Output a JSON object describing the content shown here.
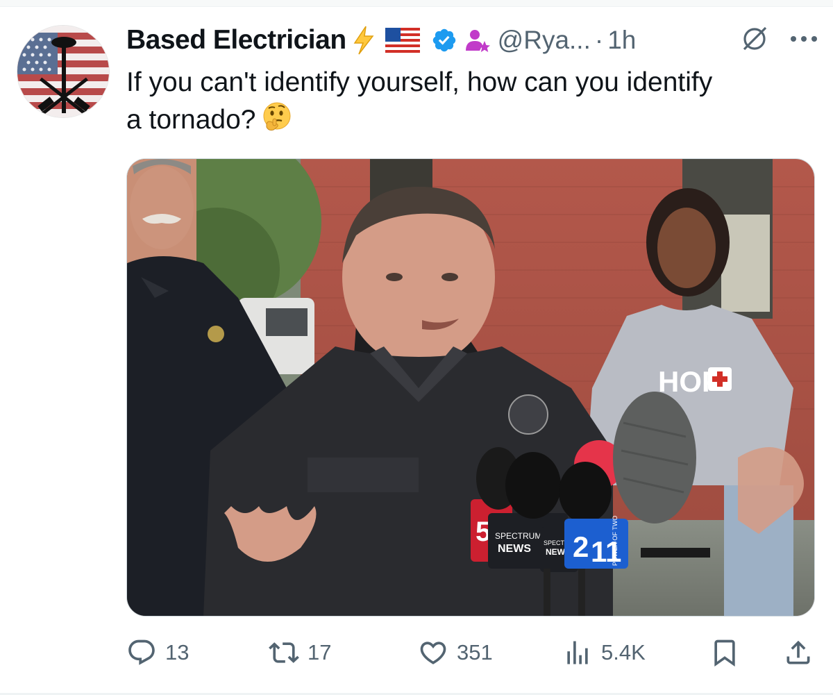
{
  "tweet": {
    "author": {
      "display_name": "Based Electrician",
      "handle": "@Rya...",
      "badges": [
        "lightning-emoji",
        "us-flag-emoji",
        "verified-badge",
        "person-star-emoji"
      ]
    },
    "separator": "·",
    "timestamp": "1h",
    "text_line1": "If you can't identify yourself, how can you identify",
    "text_line2": "a tornado?",
    "emoji": "thinking-face-emoji",
    "media": {
      "shirt_text": "HOP",
      "mic_labels": {
        "channel5": "5",
        "spectrum_top": "SPECTRUM",
        "spectrum_bottom": "NEWS",
        "spectrum_partial_top": "SPECTRU",
        "spectrum_partial_bottom": "NEW",
        "channel2": "2",
        "channel11": "11",
        "power_of_two": "POWER OF TWO"
      }
    }
  },
  "actions": {
    "replies": "13",
    "reposts": "17",
    "likes": "351",
    "views": "5.4K"
  },
  "colors": {
    "text_primary": "#0f1419",
    "text_secondary": "#536471",
    "verified_blue": "#1d9bf0",
    "accent_red": "#e0245e"
  }
}
